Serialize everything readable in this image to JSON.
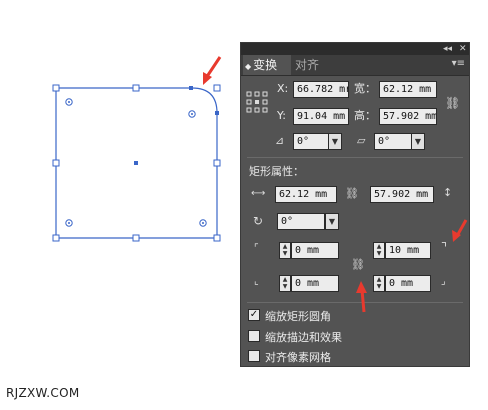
{
  "panel": {
    "collapse_icon": "double-chevron-icon",
    "close_icon": "close-icon",
    "tabs": [
      {
        "label": "变换",
        "active": true
      },
      {
        "label": "对齐",
        "active": false
      }
    ],
    "menu_icon": "panel-menu-icon"
  },
  "transform": {
    "x_label": "X:",
    "x_value": "66.782 mr",
    "y_label": "Y:",
    "y_value": "91.04 mm",
    "width_label": "宽：",
    "width_value": "62.12 mm",
    "height_label": "高：",
    "height_value": "57.902 mm",
    "rotate_value": "0°",
    "shear_value": "0°"
  },
  "rect_props": {
    "heading": "矩形属性：",
    "width_value": "62.12 mm",
    "height_value": "57.902 mm",
    "rotation_value": "0°",
    "corner_tl_value": "0 mm",
    "corner_tr_value": "10 mm",
    "corner_bl_value": "0 mm",
    "corner_br_value": "0 mm"
  },
  "options": [
    {
      "label": "缩放矩形圆角",
      "checked": true
    },
    {
      "label": "缩放描边和效果",
      "checked": false
    },
    {
      "label": "对齐像素网格",
      "checked": false
    }
  ],
  "watermark": "RJZXW.COM",
  "colors": {
    "selection_blue": "#3a66c8",
    "arrow_red": "#e83a2e",
    "panel_bg": "#535353"
  }
}
